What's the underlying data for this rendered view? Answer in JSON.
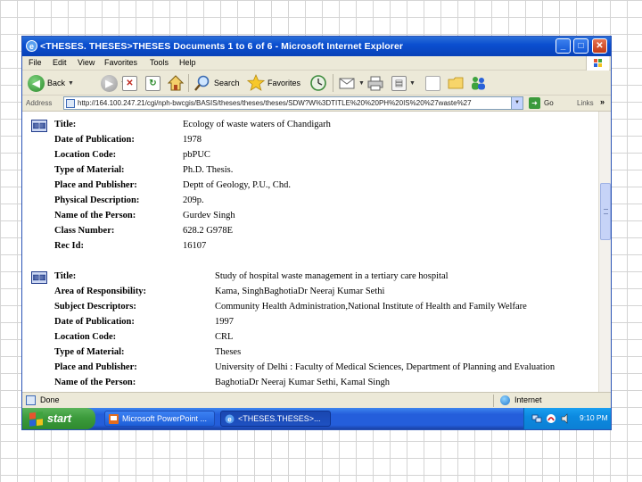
{
  "window": {
    "title": "<THESES. THESES>THESES Documents 1 to 6 of 6 - Microsoft Internet Explorer",
    "controls": [
      "_",
      "□",
      "✕"
    ]
  },
  "menu": [
    "File",
    "Edit",
    "View",
    "Favorites",
    "Tools",
    "Help"
  ],
  "toolbar": {
    "back": "Back",
    "search": "Search",
    "favorites": "Favorites"
  },
  "address": {
    "label": "Address",
    "url": "http://164.100.247.21/cgi/nph-bwcgis/BASIS/theses/theses/theses/SDW?W%3DTITLE%20%20PH%20IS%20%27waste%27",
    "go": "Go",
    "links": "Links",
    "links_more": "»"
  },
  "records": [
    {
      "icon": "book-icon",
      "fields": [
        {
          "label": "Title:",
          "value": "Ecology of waste waters of Chandigarh"
        },
        {
          "label": "Date of Publication:",
          "value": "1978"
        },
        {
          "label": "Location Code:",
          "value": "pbPUC"
        },
        {
          "label": "Type of Material:",
          "value": "Ph.D. Thesis."
        },
        {
          "label": "Place and Publisher:",
          "value": "Deptt of Geology, P.U., Chd."
        },
        {
          "label": "Physical Description:",
          "value": "209p."
        },
        {
          "label": "Name of the Person:",
          "value": "Gurdev Singh"
        },
        {
          "label": "Class Number:",
          "value": "628.2 G978E"
        },
        {
          "label": "Rec Id:",
          "value": "16107"
        }
      ]
    },
    {
      "icon": "book-icon",
      "fields": [
        {
          "label": "Title:",
          "value": "Study of hospital waste management in a tertiary care hospital"
        },
        {
          "label": "Area of Responsibility:",
          "value": "Kama, SinghBaghotiaDr Neeraj Kumar Sethi"
        },
        {
          "label": "Subject Descriptors:",
          "value": "Community Health Administration,National Institute of Health and Family Welfare"
        },
        {
          "label": "Date of Publication:",
          "value": "1997"
        },
        {
          "label": "Location Code:",
          "value": "CRL"
        },
        {
          "label": "Type of Material:",
          "value": "Theses"
        },
        {
          "label": "Place and Publisher:",
          "value": "University of Delhi : Faculty of Medical Sciences, Department of Planning and Evaluation"
        },
        {
          "label": "Name of the Person:",
          "value": "BaghotiaDr Neeraj Kumar Sethi, Kamal Singh"
        }
      ]
    }
  ],
  "status": {
    "text": "Done",
    "zone": "Internet"
  },
  "taskbar": {
    "start": "start",
    "tasks": [
      "Microsoft PowerPoint ...",
      "<THESES.THESES>..."
    ],
    "clock": "9:10 PM"
  }
}
